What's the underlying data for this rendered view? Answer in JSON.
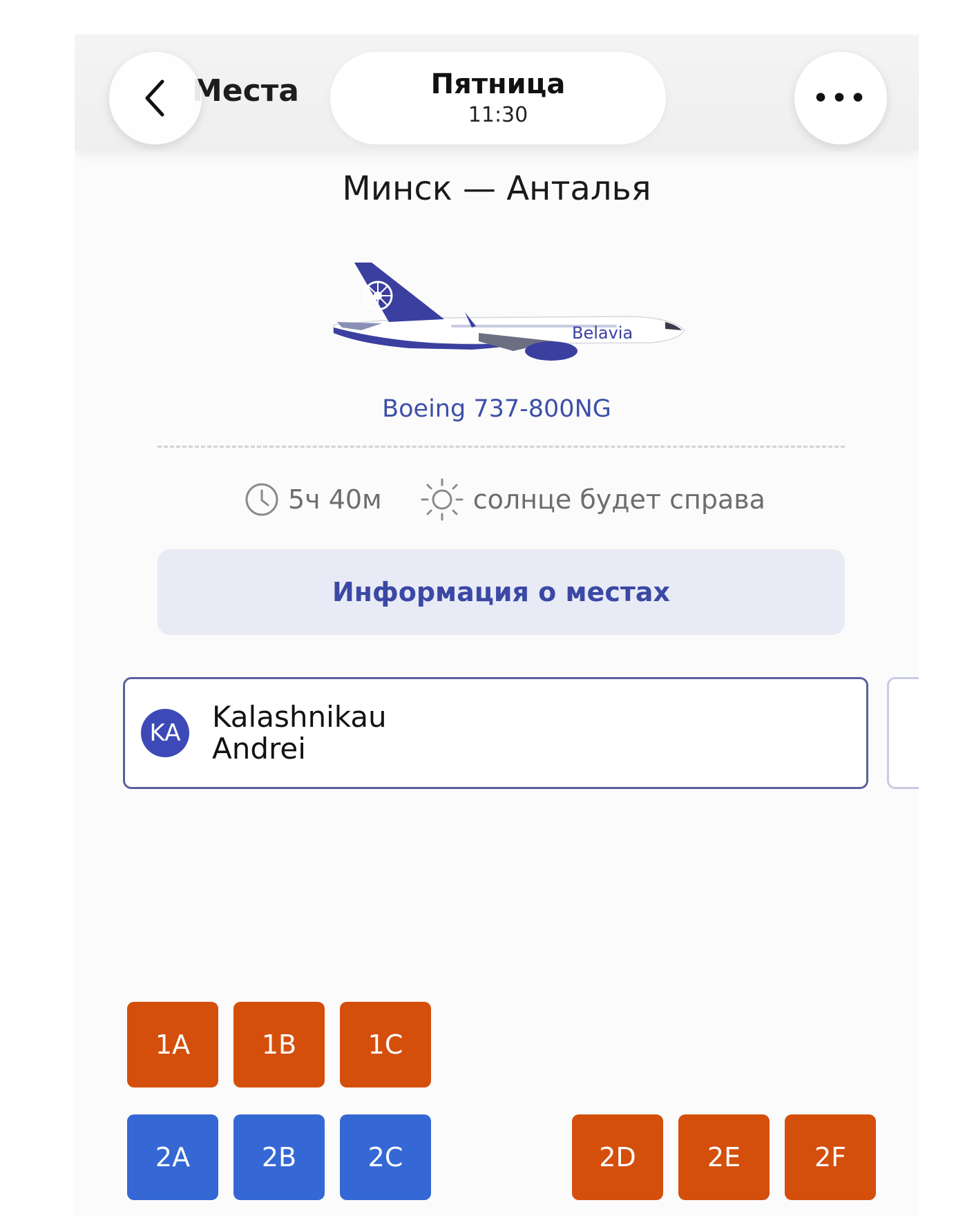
{
  "header": {
    "back_label": "Места",
    "day": "Пятница",
    "time": "11:30"
  },
  "route": "Минск — Анталья",
  "aircraft": {
    "model": "Boeing 737-800NG",
    "livery_text": "Belavia"
  },
  "flight_info": {
    "duration": "5ч 40м",
    "sun_side": "солнце будет справа"
  },
  "seat_info_button": "Информация о местах",
  "passenger": {
    "initials": "KA",
    "last_name": "Kalashnikau",
    "first_name": "Andrei"
  },
  "seats": {
    "row1": [
      {
        "label": "1A",
        "status": "occupied"
      },
      {
        "label": "1B",
        "status": "occupied"
      },
      {
        "label": "1C",
        "status": "occupied"
      }
    ],
    "row2": [
      {
        "label": "2A",
        "status": "available"
      },
      {
        "label": "2B",
        "status": "available"
      },
      {
        "label": "2C",
        "status": "available"
      },
      {
        "label": "2D",
        "status": "occupied"
      },
      {
        "label": "2E",
        "status": "occupied"
      },
      {
        "label": "2F",
        "status": "occupied"
      }
    ]
  },
  "colors": {
    "accent": "#3b48a4",
    "occupied_seat": "#d44f0c",
    "available_seat": "#3568d4",
    "avatar": "#3d49b6"
  }
}
